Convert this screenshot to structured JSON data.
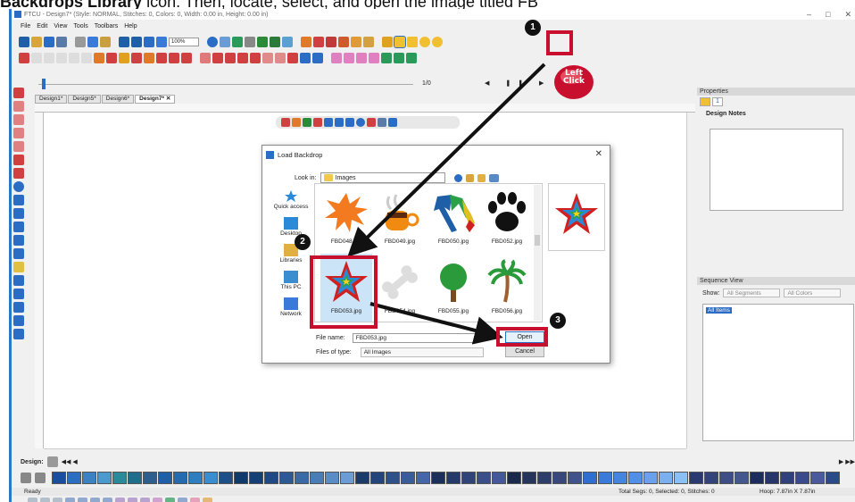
{
  "instruction": {
    "bold": "Backdrops Library",
    "text": " icon. Then, locate, select, and open the image titled FB"
  },
  "window": {
    "title": "FTCU - Design7* (Style: NORMAL, Stitches: 0, Colors: 0, Width: 0.00 in, Height: 0.00 in)",
    "controls": [
      "–",
      "□",
      "✕"
    ]
  },
  "menu": [
    "File",
    "Edit",
    "View",
    "Tools",
    "Toolbars",
    "Help"
  ],
  "toolbar": {
    "zoom": "100%",
    "frame": "1/0"
  },
  "doc_tabs": [
    "Design1*",
    "Design5*",
    "Design6*",
    "Design7*"
  ],
  "doc_tab_close": "✕",
  "properties": {
    "header": "Properties",
    "tab_number": "1",
    "notes_title": "Design Notes"
  },
  "sequence": {
    "header": "Sequence View",
    "show_label": "Show:",
    "segments": "All Segments",
    "colors": "All Colors",
    "item": "All Items"
  },
  "colorbar": {
    "design_label": "Design:",
    "nav": "◀◀ ◀",
    "nav_right": "▶ ▶▶"
  },
  "swatches": [
    "#1a4fa0",
    "#2a6fc0",
    "#3b82c4",
    "#4a9ad0",
    "#2a8a9a",
    "#1f6f8b",
    "#2e5e8e",
    "#1f5fa8",
    "#246bb0",
    "#2f7fc0",
    "#3a8ed0",
    "#1d4f88",
    "#0f3a6a",
    "#163f75",
    "#204a86",
    "#2c5a96",
    "#3b6ba6",
    "#4a7cb6",
    "#5a8cc6",
    "#6a9cd6",
    "#1a3a6a",
    "#24457a",
    "#2f518a",
    "#3a5c9a",
    "#4567aa",
    "#1b2f5a",
    "#25396a",
    "#30447a",
    "#3a4e8a",
    "#45589a",
    "#1a2a4a",
    "#24345a",
    "#2e3e6a",
    "#38487a",
    "#42528a",
    "#2f6fd0",
    "#3a7ad8",
    "#4585e0",
    "#5090e8",
    "#6aa0ec",
    "#7ab0f0",
    "#8ac0f4",
    "#2a3a70",
    "#33447a",
    "#3c4e84",
    "#45588e",
    "#1c2c5c",
    "#26366c",
    "#30407c",
    "#3a4a8c",
    "#4a5a9c",
    "#2a4a8a"
  ],
  "status": {
    "left": "Ready",
    "right": "Total Segs: 0, Selected: 0, Stitches: 0",
    "hoop": "Hoop: 7.87in X 7.87in"
  },
  "dialog": {
    "title": "Load Backdrop",
    "look_in_label": "Look in:",
    "look_in_value": "Images",
    "places": [
      "Quick access",
      "Desktop",
      "Libraries",
      "This PC",
      "Network"
    ],
    "files": [
      "FBD048.jpg",
      "FBD049.jpg",
      "FBD050.jpg",
      "FBD052.jpg",
      "FBD053.jpg",
      "FBD054.jpg",
      "FBD055.jpg",
      "FBD056.jpg"
    ],
    "file_name_label": "File name:",
    "file_name_value": "FBD053.jpg",
    "files_of_type_label": "Files of type:",
    "files_of_type_value": "All Images",
    "open_label": "Open",
    "cancel_label": "Cancel"
  },
  "annotations": {
    "steps": [
      "1",
      "2",
      "3"
    ],
    "click_text": [
      "Left",
      "Click"
    ],
    "highlight_color": "#c8102e"
  }
}
